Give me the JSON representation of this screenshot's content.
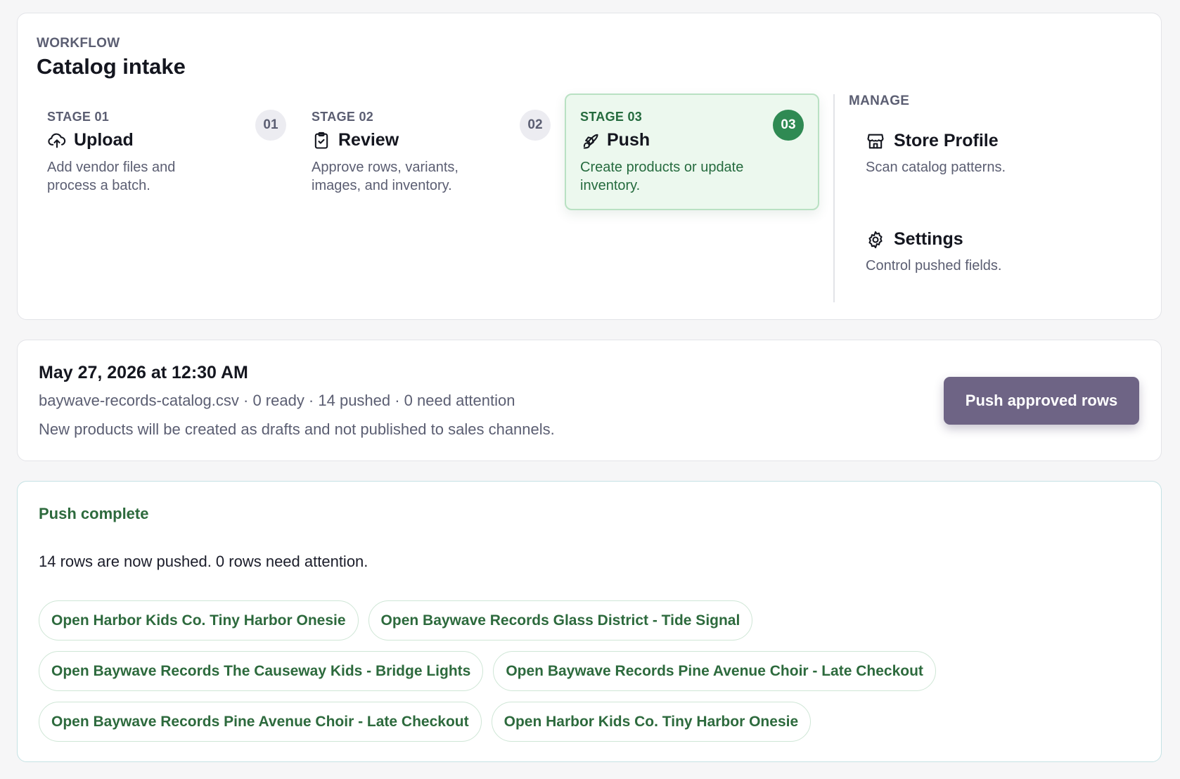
{
  "workflow": {
    "eyebrow": "WORKFLOW",
    "title": "Catalog intake",
    "stages": [
      {
        "label": "STAGE 01",
        "name": "Upload",
        "desc": "Add vendor files and process a batch.",
        "number": "01",
        "icon": "cloud-upload-icon",
        "active": false
      },
      {
        "label": "STAGE 02",
        "name": "Review",
        "desc": "Approve rows, variants, images, and inventory.",
        "number": "02",
        "icon": "clipboard-check-icon",
        "active": false
      },
      {
        "label": "STAGE 03",
        "name": "Push",
        "desc": "Create products or update inventory.",
        "number": "03",
        "icon": "rocket-icon",
        "active": true
      }
    ],
    "manage": {
      "label": "MANAGE",
      "items": [
        {
          "name": "Store Profile",
          "desc": "Scan catalog patterns.",
          "icon": "store-icon"
        },
        {
          "name": "Settings",
          "desc": "Control pushed fields.",
          "icon": "gear-icon"
        }
      ]
    }
  },
  "batch": {
    "date": "May 27, 2026 at 12:30 AM",
    "meta": "baywave-records-catalog.csv · 0 ready · 14 pushed · 0 need attention",
    "note": "New products will be created as drafts and not published to sales channels.",
    "push_button": "Push approved rows"
  },
  "result": {
    "title": "Push complete",
    "message": "14 rows are now pushed. 0 rows need attention.",
    "links": [
      "Open Harbor Kids Co. Tiny Harbor Onesie",
      "Open Baywave Records Glass District - Tide Signal",
      "Open Baywave Records The Causeway Kids - Bridge Lights",
      "Open Baywave Records Pine Avenue Choir - Late Checkout",
      "Open Baywave Records Pine Avenue Choir - Late Checkout",
      "Open Harbor Kids Co. Tiny Harbor Onesie"
    ]
  },
  "colors": {
    "accent_green": "#2f8a53",
    "active_stage_bg": "#ecf8ee",
    "push_button": "#6e6485",
    "link_text": "#2d6a3d"
  }
}
